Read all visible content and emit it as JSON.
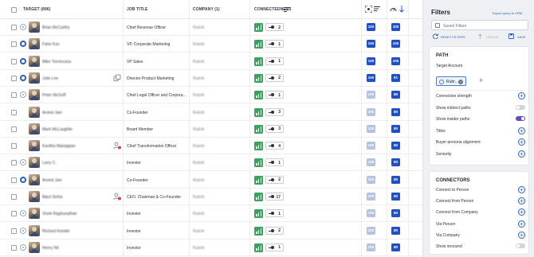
{
  "table": {
    "headers": {
      "target": "TARGET (896)",
      "job_title": "JOB TITLE",
      "company": "COMPANY (1)",
      "connectedness": "CONNECTEDNESS"
    },
    "rows": [
      {
        "name": "Brian McCarthy",
        "job": "Chief Revenue Officer",
        "company": "Rubrik",
        "strength": "2",
        "score1": "100",
        "score2": "100",
        "score1_faded": false,
        "status": "off",
        "flag": false
      },
      {
        "name": "Fahe Koo",
        "job": "VP, Corporate Marketing",
        "company": "Rubrik",
        "strength": "1",
        "score1": "100",
        "score2": "100",
        "score1_faded": false,
        "status": "on",
        "flag": false
      },
      {
        "name": "Mike Tornincasa",
        "job": "VP Sales",
        "company": "Rubrik",
        "strength": "1",
        "score1": "100",
        "score2": "100",
        "score1_faded": false,
        "status": "on",
        "flag": false
      },
      {
        "name": "Julie Lee",
        "job": "Director Product Marketing",
        "company": "Rubrik",
        "strength": "2",
        "score1": "100",
        "score2": "91",
        "score1_faded": false,
        "status": "on",
        "flag": "copy"
      },
      {
        "name": "Peter McGoff",
        "job": "Chief Legal Officer and Corporate Secretary",
        "company": "Rubrik",
        "strength": "1",
        "score1": "100",
        "score2": "80",
        "score1_faded": true,
        "status": "off",
        "flag": false
      },
      {
        "name": "Arvind Jain",
        "job": "Co-Founder",
        "company": "Rubrik",
        "strength": "3",
        "score1": "100",
        "score2": "80",
        "score1_faded": true,
        "status": "none",
        "flag": false
      },
      {
        "name": "Mark McLaughlin",
        "job": "Board Member",
        "company": "Rubrik",
        "strength": "3",
        "score1": "100",
        "score2": "80",
        "score1_faded": true,
        "status": "none",
        "flag": false
      },
      {
        "name": "Kavitha Mariappan",
        "job": "Chief Transformation Officer",
        "company": "Rubrik",
        "strength": "4",
        "score1": "100",
        "score2": "80",
        "score1_faded": true,
        "status": "none",
        "flag": "person"
      },
      {
        "name": "Larry C.",
        "job": "Investor",
        "company": "Rubrik",
        "strength": "1",
        "score1": "100",
        "score2": "80",
        "score1_faded": true,
        "status": "off",
        "flag": false
      },
      {
        "name": "Arvind Jain",
        "job": "Co-Founder",
        "company": "Rubrik",
        "strength": "2",
        "score1": "100",
        "score2": "80",
        "score1_faded": true,
        "status": "on",
        "flag": false
      },
      {
        "name": "Bipul Sinha",
        "job": "CEO, Chairman & Co-Founder",
        "company": "Rubrik",
        "strength": "17",
        "score1": "100",
        "score2": "80",
        "score1_faded": true,
        "status": "none",
        "flag": "person"
      },
      {
        "name": "Vivek Raghunathan",
        "job": "Investor",
        "company": "Rubrik",
        "strength": "1",
        "score1": "100",
        "score2": "80",
        "score1_faded": true,
        "status": "off",
        "flag": false
      },
      {
        "name": "Richard Kendel",
        "job": "Investor",
        "company": "Rubrik",
        "strength": "2",
        "score1": "100",
        "score2": "80",
        "score1_faded": true,
        "status": "off",
        "flag": false
      },
      {
        "name": "Henry Nil",
        "job": "Investor",
        "company": "Rubrik",
        "strength": "1",
        "score1": "100",
        "score2": "80",
        "score1_faded": true,
        "status": "off",
        "flag": false
      }
    ]
  },
  "filters": {
    "title": "Filters",
    "export_label": "Export query to CRM",
    "saved_placeholder": "Saved Filters",
    "reset_label": "RESET FILTERS",
    "update_label": "UPDATE",
    "save_label": "SAVE",
    "path": {
      "heading": "PATH",
      "target_account_label": "Target Account",
      "chip_label": "Rubr...",
      "items": [
        {
          "label": "Connection strength",
          "kind": "plus"
        },
        {
          "label": "Show indirect paths",
          "kind": "toggle-off"
        },
        {
          "label": "Show insider paths",
          "kind": "toggle-on"
        },
        {
          "label": "Titles",
          "kind": "plus"
        },
        {
          "label": "Buyer persona alignment",
          "kind": "plus"
        },
        {
          "label": "Seniority",
          "kind": "plus"
        }
      ]
    },
    "connectors": {
      "heading": "CONNECTORS",
      "items": [
        {
          "label": "Connect to Person",
          "kind": "plus"
        },
        {
          "label": "Connect from Person",
          "kind": "plus"
        },
        {
          "label": "Connect from Company",
          "kind": "plus"
        },
        {
          "label": "Via Person",
          "kind": "plus"
        },
        {
          "label": "Via Company",
          "kind": "plus"
        },
        {
          "label": "Show snoozed",
          "kind": "toggle-off"
        }
      ]
    }
  },
  "colors": {
    "accent_blue": "#2050c6",
    "signal_green": "#3aa35b",
    "toggle_on": "#6a48c8"
  }
}
